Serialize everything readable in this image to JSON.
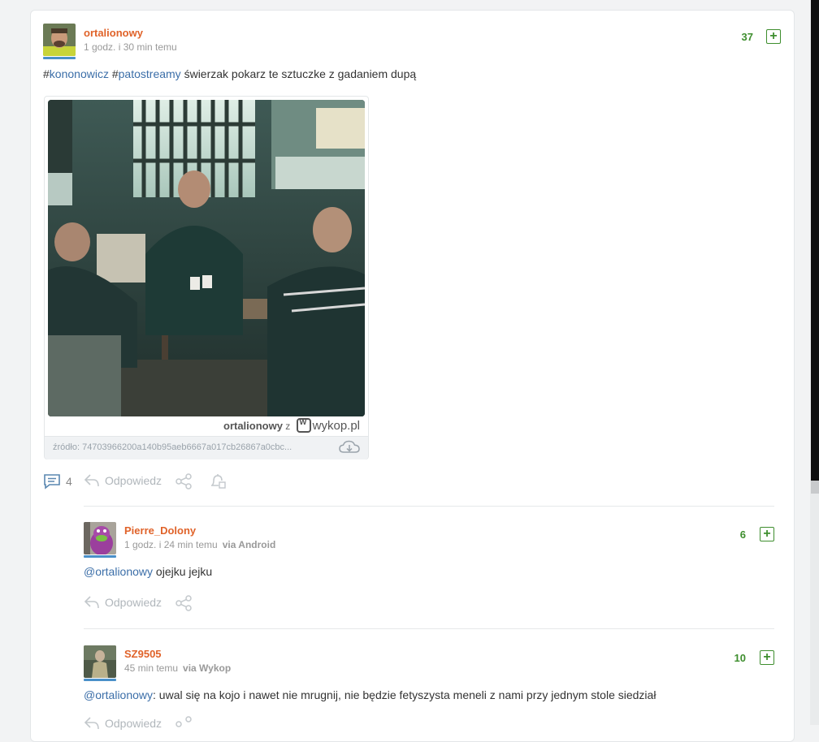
{
  "post": {
    "username": "ortalionowy",
    "time": "1 godz. i 30 min temu",
    "votes": "37",
    "tag1_hash": "#",
    "tag1": "kononowicz",
    "tag2_hash": "#",
    "tag2": "patostreamy",
    "text": "świerzak pokarz te sztuczke z gadaniem dupą",
    "watermark_user": "ortalionowy",
    "watermark_z": "z",
    "watermark_site": "wykop.pl",
    "source": "źródło: 74703966200a140b95aeb6667a017cb26867a0cbc...",
    "comments_count": "4",
    "reply_label": "Odpowiedz"
  },
  "comments": [
    {
      "username": "Pierre_Dolony",
      "time": "1 godz. i 24 min temu",
      "via": "via Android",
      "votes": "6",
      "mention": "@ortalionowy",
      "text": " ojejku jejku",
      "reply_label": "Odpowiedz"
    },
    {
      "username": "SZ9505",
      "time": "45 min temu",
      "via": "via Wykop",
      "votes": "10",
      "mention": "@ortalionowy",
      "text": ": uwal się na kojo i nawet nie mrugnij, nie będzie fetyszysta meneli z nami przy jednym stole siedział",
      "reply_label": "Odpowiedz"
    }
  ],
  "colors": {
    "username": "#e0632a",
    "tag": "#3b6ea8",
    "vote": "#3e8e2e",
    "muted": "#b0b6bb"
  },
  "icons": [
    "comment-icon",
    "reply-icon",
    "share-icon",
    "bell-icon",
    "download-icon",
    "plus-icon"
  ]
}
